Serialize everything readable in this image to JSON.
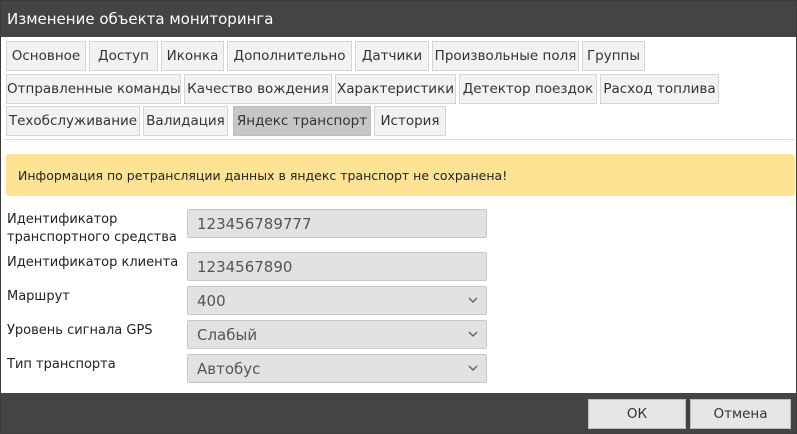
{
  "dialog": {
    "title": "Изменение объекта мониторинга"
  },
  "tabs": {
    "row1": [
      "Основное",
      "Доступ",
      "Иконка",
      "Дополнительно",
      "Датчики",
      "Произвольные поля",
      "Группы"
    ],
    "row2": [
      "Отправленные команды",
      "Качество вождения",
      "Характеристики",
      "Детектор поездок",
      "Расход топлива"
    ],
    "row3": [
      "Техобслуживание",
      "Валидация",
      "Яндекс транспорт",
      "История"
    ],
    "active": "Яндекс транспорт"
  },
  "alert": {
    "text": "Информация по ретрансляции данных в яндекс транспорт не сохранена!"
  },
  "form": {
    "vehicle_id": {
      "label_line1": "Идентификатор",
      "label_line2": "транспортного средства",
      "value": "123456789777"
    },
    "client_id": {
      "label": "Идентификатор клиента",
      "value": "1234567890"
    },
    "route": {
      "label": "Маршрут",
      "value": "400"
    },
    "gps_level": {
      "label": "Уровень сигнала GPS",
      "value": "Слабый"
    },
    "transport_type": {
      "label": "Тип транспорта",
      "value": "Автобус"
    }
  },
  "footer": {
    "ok_label": "ОК",
    "cancel_label": "Отмена"
  },
  "colors": {
    "titlebar": "#444444",
    "alert_bg": "#ffe394",
    "active_tab": "#c6c6c6",
    "field_bg": "#e2e2e2"
  },
  "icons": {
    "select_arrow": "chevron-down-icon"
  }
}
